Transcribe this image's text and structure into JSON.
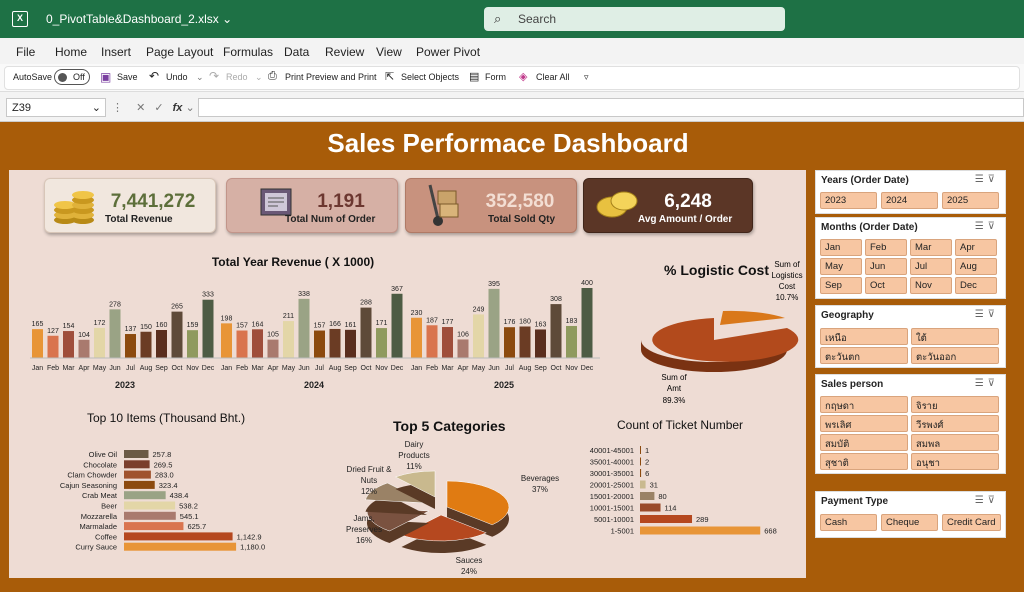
{
  "window": {
    "file_name": "0_PivotTable&Dashboard_2.xlsx",
    "search_placeholder": "Search"
  },
  "menu": [
    "File",
    "Home",
    "Insert",
    "Page Layout",
    "Formulas",
    "Data",
    "Review",
    "View",
    "Power Pivot"
  ],
  "toolbar": {
    "autosave": "AutoSave",
    "autosave_state": "Off",
    "save": "Save",
    "undo": "Undo",
    "redo": "Redo",
    "print_preview": "Print Preview and Print",
    "select_objects": "Select Objects",
    "form": "Form",
    "clear_all": "Clear All"
  },
  "formula_bar": {
    "name_box": "Z39",
    "fx": "fx",
    "formula": ""
  },
  "dashboard": {
    "title": "Sales Performace Dashboard",
    "kpis": [
      {
        "value": "7,441,272",
        "label": "Total Revenue",
        "icon": "coin-stack-icon"
      },
      {
        "value": "1,191",
        "label": "Total Num of Order",
        "icon": "invoice-folder-icon"
      },
      {
        "value": "352,580",
        "label": "Total Sold Qty",
        "icon": "hand-truck-icon"
      },
      {
        "value": "6,248",
        "label": "Avg Amount / Order",
        "icon": "gold-coins-icon"
      }
    ]
  },
  "chart_data": [
    {
      "type": "bar",
      "title": "Total Year Revenue ( X 1000)",
      "categories": [
        "Jan",
        "Feb",
        "Mar",
        "Apr",
        "May",
        "Jun",
        "Jul",
        "Aug",
        "Sep",
        "Oct",
        "Nov",
        "Dec"
      ],
      "series": [
        {
          "name": "2023",
          "values": [
            165,
            127,
            154,
            104,
            172,
            278,
            137,
            150,
            160,
            265,
            159,
            333
          ]
        },
        {
          "name": "2024",
          "values": [
            198,
            157,
            164,
            105,
            211,
            338,
            157,
            166,
            161,
            288,
            171,
            367
          ]
        },
        {
          "name": "2025",
          "values": [
            230,
            187,
            177,
            106,
            249,
            395,
            176,
            180,
            163,
            308,
            183,
            400
          ]
        }
      ]
    },
    {
      "type": "pie",
      "title": "% Logistic Cost",
      "slices": [
        {
          "label": "Sum of Logistics Cost",
          "pct": "10.7%",
          "value": 10.7,
          "color": "#d9781a"
        },
        {
          "label": "Sum of Amt",
          "pct": "89.3%",
          "value": 89.3,
          "color": "#b24a1c"
        }
      ]
    },
    {
      "type": "bar",
      "title": "Top 10 Items (Thousand Bht.)",
      "categories": [
        "Olive Oil",
        "Chocolate",
        "Clam Chowder",
        "Cajun Seasoning",
        "Crab Meat",
        "Beer",
        "Mozzarella",
        "Marmalade",
        "Coffee",
        "Curry Sauce"
      ],
      "values": [
        257.8,
        269.5,
        283.0,
        323.4,
        438.4,
        538.2,
        545.1,
        625.7,
        1142.9,
        1180.0
      ],
      "value_labels": [
        "257.8",
        "269.5",
        "283.0",
        "323.4",
        "438.4",
        "538.2",
        "545.1",
        "625.7",
        "1,142.9",
        "1,180.0"
      ]
    },
    {
      "type": "pie",
      "title": "Top 5 Categories",
      "slices": [
        {
          "label": "Beverages",
          "pct": "37%",
          "value": 37,
          "color": "#e07b12"
        },
        {
          "label": "Sauces",
          "pct": "24%",
          "value": 24,
          "color": "#b5481f"
        },
        {
          "label": "Jams, Preserves",
          "pct": "16%",
          "value": 16,
          "color": "#7a5240"
        },
        {
          "label": "Dried Fruit & Nuts",
          "pct": "12%",
          "value": 12,
          "color": "#9a8266"
        },
        {
          "label": "Dairy Products",
          "pct": "11%",
          "value": 11,
          "color": "#c9b98e"
        }
      ]
    },
    {
      "type": "bar",
      "title": "Count of Ticket Number",
      "categories": [
        "40001-45001",
        "35001-40001",
        "30001-35001",
        "20001-25001",
        "15001-20001",
        "10001-15001",
        "5001-10001",
        "1-5001"
      ],
      "values": [
        1,
        2,
        6,
        31,
        80,
        114,
        289,
        668
      ]
    }
  ],
  "slicers": [
    {
      "title": "Years (Order Date)",
      "items": [
        "2023",
        "2024",
        "2025"
      ]
    },
    {
      "title": "Months (Order Date)",
      "items": [
        "Jan",
        "Feb",
        "Mar",
        "Apr",
        "May",
        "Jun",
        "Jul",
        "Aug",
        "Sep",
        "Oct",
        "Nov",
        "Dec"
      ]
    },
    {
      "title": "Geography",
      "items": [
        "เหนือ",
        "ใต้",
        "ตะวันตก",
        "ตะวันออก"
      ]
    },
    {
      "title": "Sales person",
      "items": [
        "กฤษดา",
        "จิราย",
        "พรเลิศ",
        "วีรพงศ์",
        "สมบัติ",
        "สมพล",
        "สุชาติ",
        "อนุชา"
      ]
    },
    {
      "title": "Payment Type",
      "items": [
        "Cash",
        "Cheque",
        "Credit Card"
      ]
    }
  ]
}
